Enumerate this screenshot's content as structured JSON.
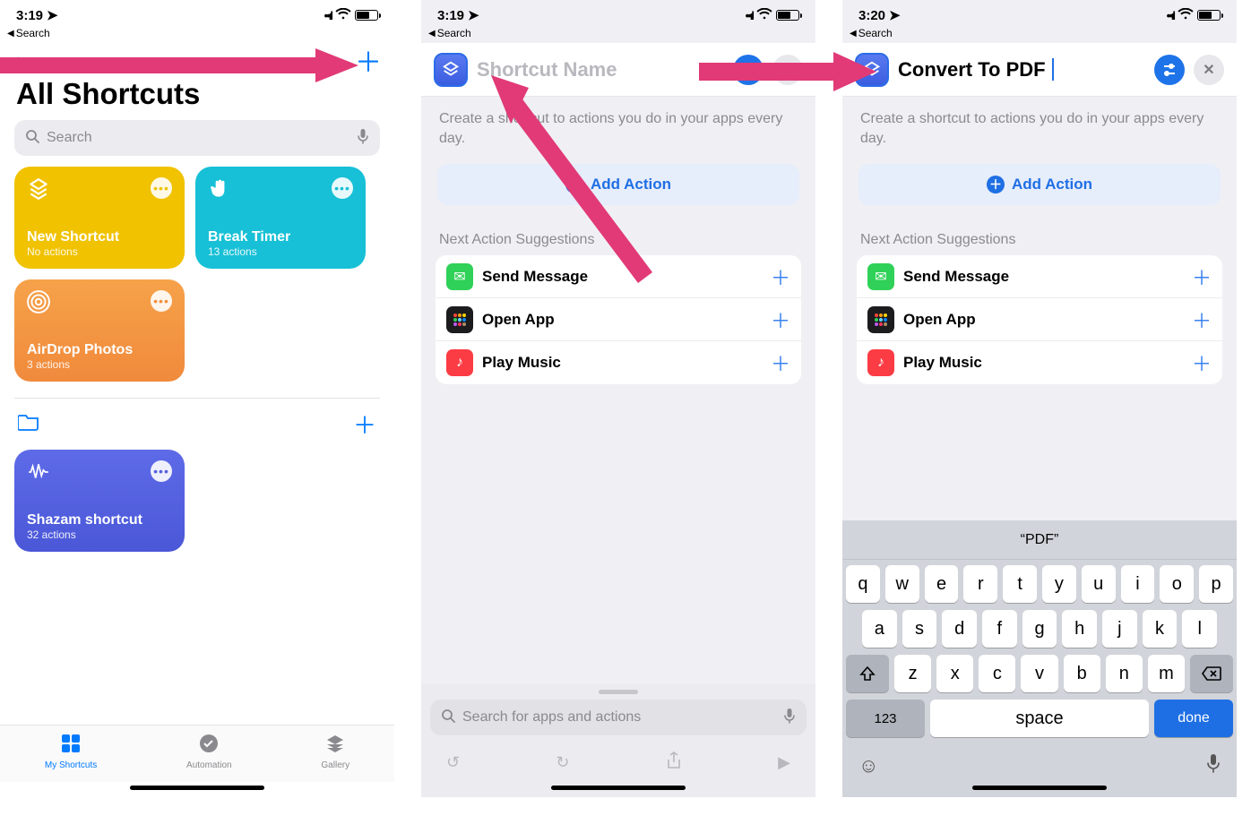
{
  "screen1": {
    "status_time": "3:19",
    "back_search": "Search",
    "title": "All Shortcuts",
    "search_placeholder": "Search",
    "cards": [
      {
        "name": "New Shortcut",
        "sub": "No actions"
      },
      {
        "name": "Break Timer",
        "sub": "13 actions"
      },
      {
        "name": "AirDrop Photos",
        "sub": "3 actions"
      },
      {
        "name": "Shazam shortcut",
        "sub": "32 actions"
      }
    ],
    "tabs": {
      "my": "My Shortcuts",
      "auto": "Automation",
      "gallery": "Gallery"
    }
  },
  "screen2": {
    "status_time": "3:19",
    "back_search": "Search",
    "title_placeholder": "Shortcut Name",
    "subtitle": "Create a shortcut to actions you do in your apps every day.",
    "add_action": "Add Action",
    "sugg_label": "Next Action Suggestions",
    "suggestions": [
      {
        "label": "Send Message"
      },
      {
        "label": "Open App"
      },
      {
        "label": "Play Music"
      }
    ],
    "search_placeholder": "Search for apps and actions"
  },
  "screen3": {
    "status_time": "3:20",
    "back_search": "Search",
    "title": "Convert To PDF",
    "subtitle": "Create a shortcut to actions you do in your apps every day.",
    "add_action": "Add Action",
    "sugg_label": "Next Action Suggestions",
    "suggestions": [
      {
        "label": "Send Message"
      },
      {
        "label": "Open App"
      },
      {
        "label": "Play Music"
      }
    ],
    "kb_suggestion": "“PDF”",
    "kb_rows": {
      "r1": [
        "q",
        "w",
        "e",
        "r",
        "t",
        "y",
        "u",
        "i",
        "o",
        "p"
      ],
      "r2": [
        "a",
        "s",
        "d",
        "f",
        "g",
        "h",
        "j",
        "k",
        "l"
      ],
      "r3": [
        "z",
        "x",
        "c",
        "v",
        "b",
        "n",
        "m"
      ]
    },
    "kb_num": "123",
    "kb_space": "space",
    "kb_done": "done"
  }
}
